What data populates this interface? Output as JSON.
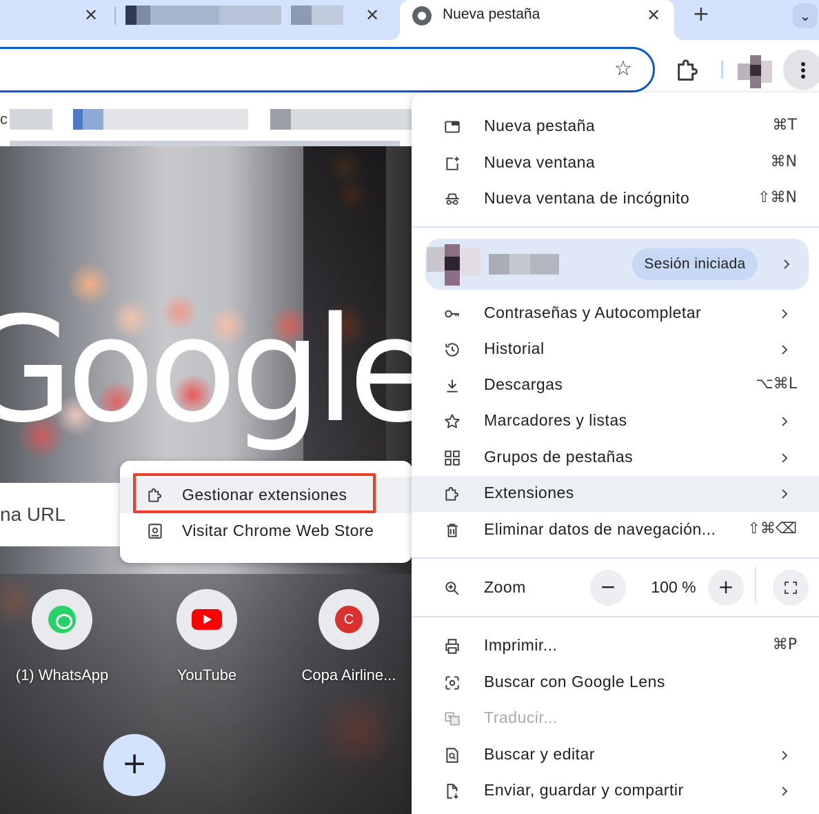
{
  "tabs": [
    {
      "title": "",
      "active": false
    },
    {
      "title": "",
      "active": false
    },
    {
      "title": "Nueva pestaña",
      "active": true
    }
  ],
  "tab_close_glyph": "✕",
  "new_tab_glyph": "+",
  "tab_search_glyph": "⌄",
  "bookmarks": {
    "visible_text": "c"
  },
  "page": {
    "logo_text": "Google",
    "search_text": "na URL",
    "shortcuts": [
      {
        "label": "(1) WhatsApp",
        "icon": "whatsapp-icon"
      },
      {
        "label": "YouTube",
        "icon": "youtube-icon"
      },
      {
        "label": "Copa Airline...",
        "icon": "copa-airlines-icon",
        "letter": "C"
      }
    ],
    "add_shortcut_glyph": "+"
  },
  "submenu": {
    "items": [
      {
        "label": "Gestionar extensiones",
        "icon": "puzzle-icon"
      },
      {
        "label": "Visitar Chrome Web Store",
        "icon": "web-store-icon"
      }
    ]
  },
  "menu": {
    "group1": [
      {
        "label": "Nueva pestaña",
        "shortcut": "⌘T",
        "icon": "new-tab-icon"
      },
      {
        "label": "Nueva ventana",
        "shortcut": "⌘N",
        "icon": "new-window-icon"
      },
      {
        "label": "Nueva ventana de incógnito",
        "shortcut": "⇧⌘N",
        "icon": "incognito-icon"
      }
    ],
    "profile": {
      "session_label": "Sesión iniciada"
    },
    "group2": [
      {
        "label": "Contraseñas y Autocompletar",
        "icon": "key-icon",
        "submenu": true
      },
      {
        "label": "Historial",
        "icon": "history-icon",
        "submenu": true
      },
      {
        "label": "Descargas",
        "icon": "download-icon",
        "shortcut": "⌥⌘L"
      },
      {
        "label": "Marcadores y listas",
        "icon": "star-icon",
        "submenu": true
      },
      {
        "label": "Grupos de pestañas",
        "icon": "tab-groups-icon",
        "submenu": true
      },
      {
        "label": "Extensiones",
        "icon": "puzzle-icon",
        "submenu": true,
        "highlighted": true
      },
      {
        "label": "Eliminar datos de navegación...",
        "icon": "trash-icon",
        "shortcut": "⇧⌘⌫"
      }
    ],
    "zoom": {
      "label": "Zoom",
      "value": "100 %",
      "minus": "−",
      "plus": "+"
    },
    "group3": [
      {
        "label": "Imprimir...",
        "icon": "printer-icon",
        "shortcut": "⌘P"
      },
      {
        "label": "Buscar con Google Lens",
        "icon": "google-lens-icon"
      },
      {
        "label": "Traducir...",
        "icon": "translate-icon",
        "disabled": true
      },
      {
        "label": "Buscar y editar",
        "icon": "find-icon",
        "submenu": true
      },
      {
        "label": "Enviar, guardar y compartir",
        "icon": "share-icon",
        "submenu": true
      }
    ]
  },
  "colors": {
    "tabstrip": "#d3e3fd",
    "omnibox_border": "#0b57d0",
    "highlight_box": "#e8402a",
    "profile_row": "#dfe8f7"
  }
}
